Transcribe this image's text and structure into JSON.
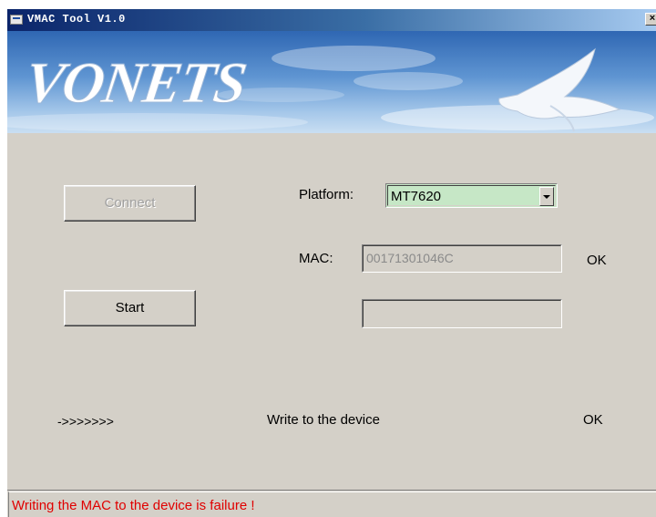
{
  "window": {
    "title": "VMAC Tool V1.0",
    "close_symbol": "×",
    "brand_logo_text": "VONETS"
  },
  "form": {
    "connect_label": "Connect",
    "connect_enabled": false,
    "start_label": "Start",
    "platform_label": "Platform:",
    "platform_value": "MT7620",
    "mac_label": "MAC:",
    "mac_value": "00171301046C",
    "mac_status": "OK",
    "second_field_value": ""
  },
  "progress": {
    "arrows": "->>>>>>>",
    "write_label": "Write to the device",
    "write_status": "OK"
  },
  "status": {
    "message": "Writing the MAC to the device is failure !",
    "color": "#e00000"
  },
  "colors": {
    "title_bar": "#0a246a",
    "combo_bg": "#c6e7c6",
    "window_bg": "#d4d0c8"
  },
  "icons": {
    "app": "app-icon",
    "close": "close-icon",
    "combo": "chevron-down-icon",
    "banner": "dove-icon"
  }
}
